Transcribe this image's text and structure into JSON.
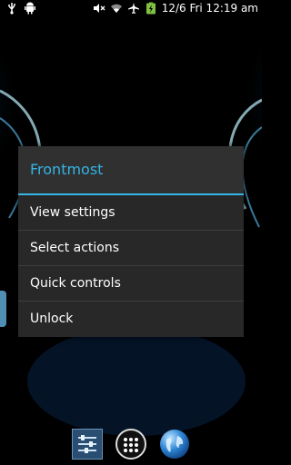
{
  "status_bar": {
    "left_icons": [
      "usb-icon",
      "android-icon"
    ],
    "right_icons": [
      "mute-icon",
      "wifi-icon",
      "airplane-icon",
      "battery-charging-icon"
    ],
    "time": "12/6 Fri 12:19 am"
  },
  "dialog": {
    "title": "Frontmost",
    "items": [
      {
        "label": "View settings"
      },
      {
        "label": "Select actions"
      },
      {
        "label": "Quick controls"
      },
      {
        "label": "Unlock"
      }
    ]
  },
  "dock": {
    "icons": [
      "settings-sliders-icon",
      "app-drawer-icon",
      "browser-globe-icon"
    ]
  },
  "colors": {
    "accent": "#33b5e5",
    "dialog_bg": "#282828",
    "title_bg": "#303030"
  }
}
